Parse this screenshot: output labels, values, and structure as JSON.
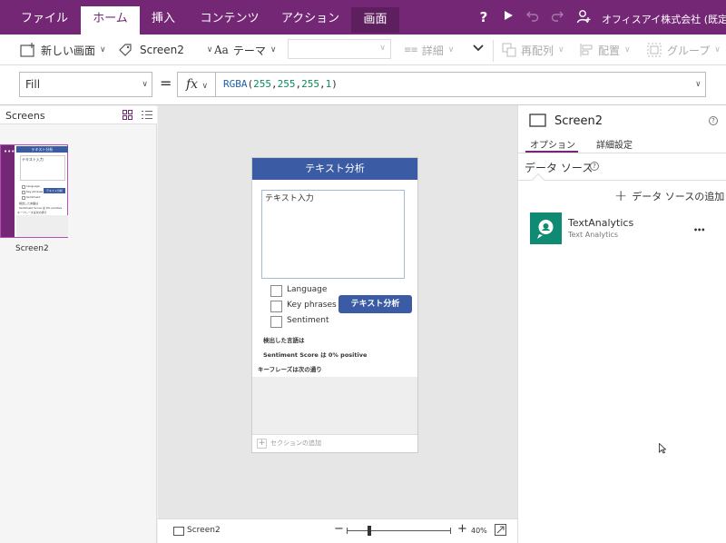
{
  "menu": {
    "tabs": [
      "ファイル",
      "ホーム",
      "挿入",
      "コンテンツ",
      "アクション",
      "画面"
    ],
    "org": "オフィスアイ株式会社 (既定)"
  },
  "ribbon": {
    "new_screen": "新しい画面",
    "screen_name": "Screen2",
    "theme": "テーマ",
    "details": "詳細",
    "reorder": "再配列",
    "align": "配置",
    "group": "グループ"
  },
  "formula": {
    "property": "Fill",
    "equals": "=",
    "fx": "fx",
    "fn_name": "RGBA",
    "open_paren": "(",
    "args": [
      "255",
      "255",
      "255",
      "1"
    ],
    "comma": ",",
    "close_paren": ")"
  },
  "left": {
    "title": "Screens",
    "thumb_label": "Screen2",
    "thumb_header": "テキスト分析",
    "thumb_input": "テキスト入力",
    "thumb_btn": "テキスト分析",
    "thumb_cb": [
      "Language",
      "Key phrases",
      "Sentiment"
    ],
    "thumb_lines": [
      "検出した言語は",
      "Sentiment Score は 0% positive",
      "キーフレーズは次の通り"
    ]
  },
  "app": {
    "header": "テキスト分析",
    "input_placeholder": "テキスト入力",
    "checkboxes": [
      "Language",
      "Key phrases",
      "Sentiment"
    ],
    "analyze_button": "テキスト分析",
    "detected_language": "検出した言語は",
    "sentiment_score": "Sentiment Score は 0% positive",
    "key_phrases": "キーフレーズは次の通り",
    "add_section": "セクションの追加"
  },
  "status": {
    "screen": "Screen2",
    "zoom_minus": "−",
    "zoom_plus": "+",
    "zoom": "40%",
    "zoom_fraction": 0.4
  },
  "right": {
    "title": "Screen2",
    "tabs": [
      "オプション",
      "詳細設定"
    ],
    "section": "データ ソース",
    "add_source": "データ ソースの追加",
    "source_name": "TextAnalytics",
    "source_sub": "Text Analytics",
    "more": "•••",
    "help": "?"
  },
  "colors": {
    "brand": "#742774",
    "app_header": "#3b5ba5",
    "source_icon": "#0f8a73"
  }
}
